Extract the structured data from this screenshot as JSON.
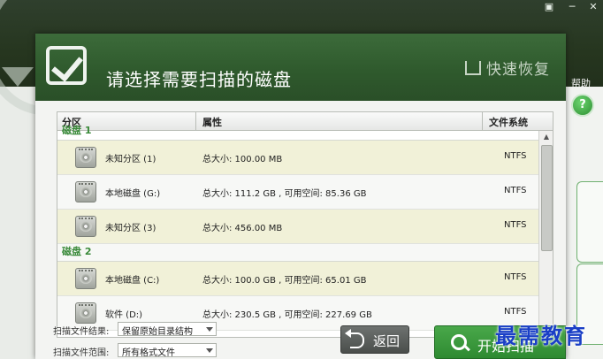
{
  "window": {
    "help_label": "帮助",
    "help_symbol": "?"
  },
  "dialog": {
    "title": "请选择需要扫描的磁盘",
    "brand": "快速恢复"
  },
  "table": {
    "columns": [
      "分区",
      "属性",
      "文件系统"
    ],
    "groups": [
      {
        "label": "磁盘 1"
      },
      {
        "label": "磁盘 2"
      }
    ],
    "rows": [
      {
        "name": "未知分区 (1)",
        "attr": "总大小: 100.00 MB",
        "fs": "NTFS"
      },
      {
        "name": "本地磁盘 (G:)",
        "attr": "总大小: 111.2 GB , 可用空间: 85.36 GB",
        "fs": "NTFS"
      },
      {
        "name": "未知分区 (3)",
        "attr": "总大小: 456.00 MB",
        "fs": "NTFS"
      },
      {
        "name": "本地磁盘 (C:)",
        "attr": "总大小: 100.0 GB , 可用空间: 65.01 GB",
        "fs": "NTFS"
      },
      {
        "name": "软件 (D:)",
        "attr": "总大小: 230.5 GB , 可用空间: 227.69 GB",
        "fs": "NTFS"
      }
    ]
  },
  "options": {
    "scan_result_label": "扫描文件结果:",
    "scan_result_value": "保留原始目录结构",
    "scan_range_label": "扫描文件范围:",
    "scan_range_value": "所有格式文件"
  },
  "buttons": {
    "back": "返回",
    "start": "开始扫描"
  },
  "watermark": "最需教育",
  "colors": {
    "header_green": "#2f5a2d",
    "start_green": "#3a9a3c",
    "row_highlight": "#f1f1d8"
  }
}
